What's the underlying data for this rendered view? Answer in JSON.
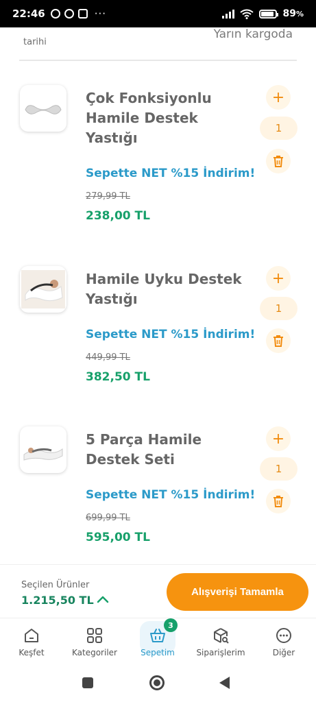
{
  "status_bar": {
    "time": "22:46",
    "battery": "89",
    "battery_unit": "%",
    "more": "···"
  },
  "header_partial": {
    "date_label": "tarihi",
    "shipping": "Yarın kargoda"
  },
  "cart_items": [
    {
      "title_lines": [
        "Çok Fonksiyonlu",
        "Hamile Destek",
        "Yastığı"
      ],
      "promo": "Sepette NET %15 İndirim!",
      "old_price": "279,99 TL",
      "new_price": "238,00 TL",
      "quantity": "1",
      "plus": "+"
    },
    {
      "title_lines": [
        "Hamile Uyku Destek",
        "Yastığı"
      ],
      "promo": "Sepette NET %15 İndirim!",
      "old_price": "449,99 TL",
      "new_price": "382,50 TL",
      "quantity": "1",
      "plus": "+"
    },
    {
      "title_lines": [
        "5 Parça Hamile",
        "Destek Seti"
      ],
      "promo": "Sepette NET %15 İndirim!",
      "old_price": "699,99 TL",
      "new_price": "595,00 TL",
      "quantity": "1",
      "plus": "+"
    }
  ],
  "summary": {
    "label": "Seçilen Ürünler",
    "total": "1.215,50 TL",
    "checkout_label": "Alışverişi Tamamla"
  },
  "bottom_nav": {
    "items": [
      {
        "label": "Keşfet",
        "icon": "home-icon"
      },
      {
        "label": "Kategoriler",
        "icon": "grid-icon"
      },
      {
        "label": "Sepetim",
        "icon": "basket-icon",
        "badge": "3"
      },
      {
        "label": "Siparişlerim",
        "icon": "package-search-icon"
      },
      {
        "label": "Diğer",
        "icon": "more-icon"
      }
    ]
  },
  "colors": {
    "accent_orange": "#f6930f",
    "promo_blue": "#2b9ac9",
    "price_green": "#17a06a"
  }
}
